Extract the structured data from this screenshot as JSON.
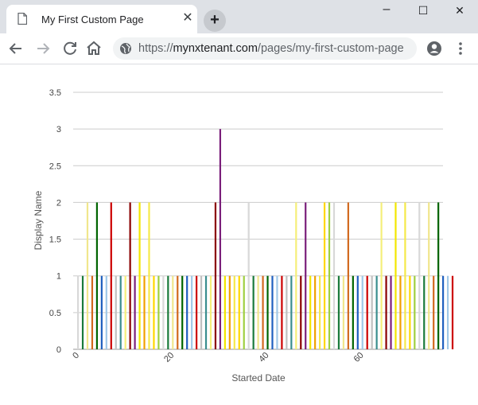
{
  "browser": {
    "tab_title": "My First Custom Page",
    "tab_close": "✕",
    "new_tab": "+",
    "window_controls": {
      "minimize": "–",
      "maximize": "☐",
      "close": "✕"
    },
    "url_host": "mynxtenant.com",
    "url_prefix": "https://",
    "url_path": "/pages/my-first-custom-page",
    "icons": [
      "page-icon",
      "back-icon",
      "forward-icon",
      "reload-icon",
      "home-icon",
      "globe-icon",
      "profile-icon",
      "kebab-menu-icon"
    ]
  },
  "chart_data": {
    "type": "bar",
    "xlabel": "Started Date",
    "ylabel": "Display Name",
    "ylim": [
      0,
      3.5
    ],
    "yticks": [
      "0",
      "0.5",
      "1",
      "1.5",
      "2",
      "2.5",
      "3",
      "3.5"
    ],
    "xlim": [
      -1,
      77
    ],
    "xticks": [
      0,
      20,
      40,
      60
    ],
    "grid": true,
    "legend": "none",
    "values": [
      1,
      1,
      2,
      1,
      2,
      1,
      1,
      2,
      1,
      1,
      1,
      2,
      1,
      2,
      1,
      2,
      1,
      1,
      1,
      1,
      1,
      1,
      1,
      1,
      1,
      1,
      1,
      1,
      1,
      2,
      3,
      1,
      1,
      1,
      1,
      1,
      2,
      1,
      1,
      1,
      1,
      1,
      1,
      1,
      1,
      1,
      2,
      1,
      2,
      1,
      1,
      1,
      2,
      2,
      2,
      1,
      1,
      2,
      1,
      1,
      1,
      1,
      1,
      1,
      2,
      1,
      1,
      2,
      1,
      2,
      1,
      1,
      2,
      1,
      2,
      1,
      2,
      1,
      1,
      1
    ],
    "palette": [
      "#f5e94a",
      "#f5ef7a",
      "#1f5fbf",
      "#d8d8d8",
      "#f2e600",
      "#c0c0c0",
      "#d2691e",
      "#ffd700",
      "#8b0000",
      "#a0c8e8",
      "#1a7a3a",
      "#f0a000",
      "#3a8e8e",
      "#006400",
      "#9fcf3f",
      "#7a1f7a",
      "#cc0000",
      "#f0e68c"
    ]
  }
}
